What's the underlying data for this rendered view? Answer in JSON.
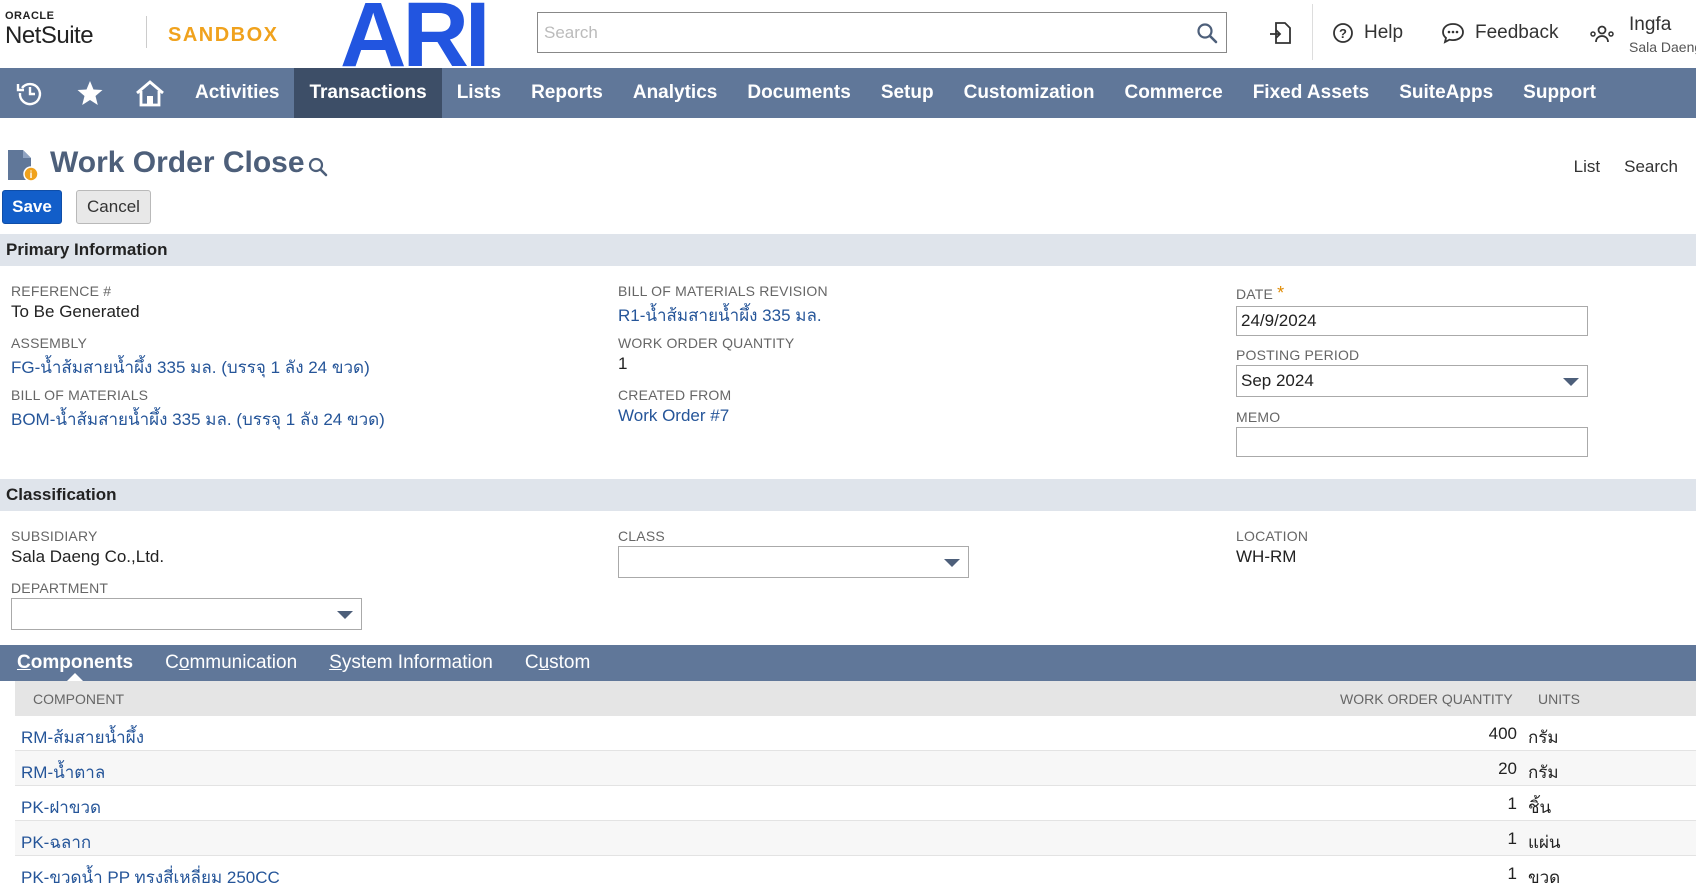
{
  "header": {
    "oracle": "ORACLE",
    "netsuite": "NetSuite",
    "environment": "SANDBOX",
    "company_logo": "ARI",
    "search_placeholder": "Search",
    "help": "Help",
    "feedback": "Feedback",
    "user_name": "Ingfa",
    "user_company": "Sala Daeng"
  },
  "nav": {
    "items": [
      "Activities",
      "Transactions",
      "Lists",
      "Reports",
      "Analytics",
      "Documents",
      "Setup",
      "Customization",
      "Commerce",
      "Fixed Assets",
      "SuiteApps",
      "Support"
    ],
    "active": "Transactions"
  },
  "page": {
    "title": "Work Order Close",
    "links": [
      "List",
      "Search"
    ],
    "save_label": "Save",
    "cancel_label": "Cancel"
  },
  "primary": {
    "header": "Primary Information",
    "reference_label": "REFERENCE #",
    "reference_value": "To Be Generated",
    "assembly_label": "ASSEMBLY",
    "assembly_value": "FG-น้ำส้มสายน้ำผึ้ง 335 มล. (บรรจุ 1 ลัง 24 ขวด)",
    "bom_label": "BILL OF MATERIALS",
    "bom_value": "BOM-น้ำส้มสายน้ำผึ้ง 335 มล. (บรรจุ 1 ลัง 24 ขวด)",
    "bom_revision_label": "BILL OF MATERIALS REVISION",
    "bom_revision_value": "R1-น้ำส้มสายน้ำผึ้ง 335 มล.",
    "wo_qty_label": "WORK ORDER QUANTITY",
    "wo_qty_value": "1",
    "created_from_label": "CREATED FROM",
    "created_from_value": "Work Order #7",
    "date_label": "DATE",
    "date_required": "*",
    "date_value": "24/9/2024",
    "posting_period_label": "POSTING PERIOD",
    "posting_period_value": "Sep 2024",
    "memo_label": "MEMO",
    "memo_value": ""
  },
  "classification": {
    "header": "Classification",
    "subsidiary_label": "SUBSIDIARY",
    "subsidiary_value": "Sala Daeng Co.,Ltd.",
    "department_label": "DEPARTMENT",
    "department_value": "",
    "class_label": "CLASS",
    "class_value": "",
    "location_label": "LOCATION",
    "location_value": "WH-RM"
  },
  "tabs": [
    {
      "ul": "C",
      "rest": "omponents"
    },
    {
      "pre": "C",
      "ul": "o",
      "rest": "mmunication"
    },
    {
      "ul": "S",
      "rest": "ystem Information"
    },
    {
      "pre": "C",
      "ul": "u",
      "rest": "stom"
    }
  ],
  "components_table": {
    "headers": [
      "COMPONENT",
      "WORK ORDER QUANTITY",
      "UNITS"
    ],
    "rows": [
      {
        "component": "RM-ส้มสายน้ำผึ้ง",
        "qty": "400",
        "units": "กรัม"
      },
      {
        "component": "RM-น้ำตาล",
        "qty": "20",
        "units": "กรัม"
      },
      {
        "component": "PK-ฝาขวด",
        "qty": "1",
        "units": "ชิ้น"
      },
      {
        "component": "PK-ฉลาก",
        "qty": "1",
        "units": "แผ่น"
      },
      {
        "component": "PK-ขวดน้ำ PP ทรงสี่เหลี่ยม 250CC",
        "qty": "1",
        "units": "ขวด"
      }
    ]
  },
  "colors": {
    "nav_bg": "#607799",
    "nav_active": "#3d4e67",
    "save_button": "#125ec9",
    "sandbox": "#f0a21d",
    "link": "#255599",
    "ari_logo": "#2255e0"
  }
}
